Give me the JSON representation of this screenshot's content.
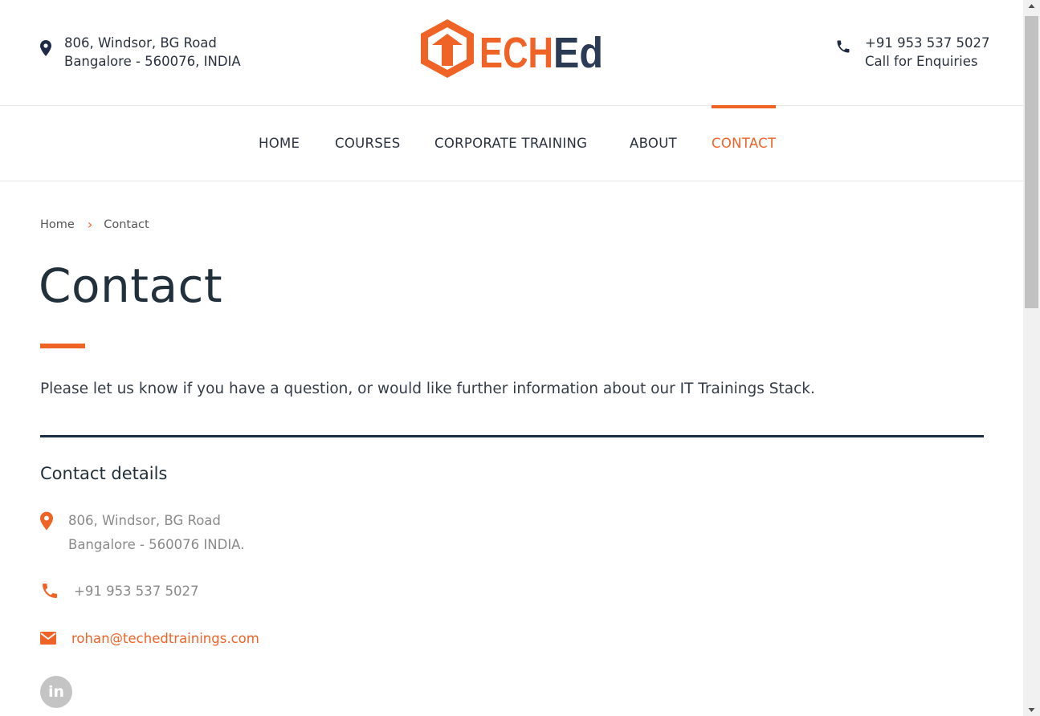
{
  "header": {
    "address_line1": "806, Windsor, BG Road",
    "address_line2": "Bangalore - 560076, INDIA",
    "phone": "+91 953 537 5027",
    "phone_caption": "Call for Enquiries",
    "logo_text_ech": "ECH",
    "logo_text_ed": "Ed"
  },
  "nav": {
    "items": [
      {
        "label": "HOME"
      },
      {
        "label": "COURSES"
      },
      {
        "label": "CORPORATE TRAINING"
      },
      {
        "label": "ABOUT"
      },
      {
        "label": "CONTACT"
      }
    ],
    "active": "CONTACT"
  },
  "breadcrumb": {
    "home": "Home",
    "separator": "›",
    "current": "Contact"
  },
  "page": {
    "title": "Contact",
    "intro": "Please let us know if you have a question, or would like further information about our IT Trainings Stack."
  },
  "contact_details": {
    "title": "Contact details",
    "address_line1": "806, Windsor, BG Road",
    "address_line2": "Bangalore - 560076 INDIA.",
    "phone": "+91 953 537 5027",
    "email": "rohan@techedtrainings.com",
    "social_linkedin": "in"
  },
  "colors": {
    "accent": "#ef6327",
    "navy": "#2b3a55",
    "divider": "#1c2e47",
    "text": "#2b3340",
    "muted": "#8a8a8a"
  },
  "icons": [
    "map-pin-icon",
    "phone-icon",
    "envelope-icon",
    "linkedin-icon",
    "chevron-right-icon"
  ]
}
